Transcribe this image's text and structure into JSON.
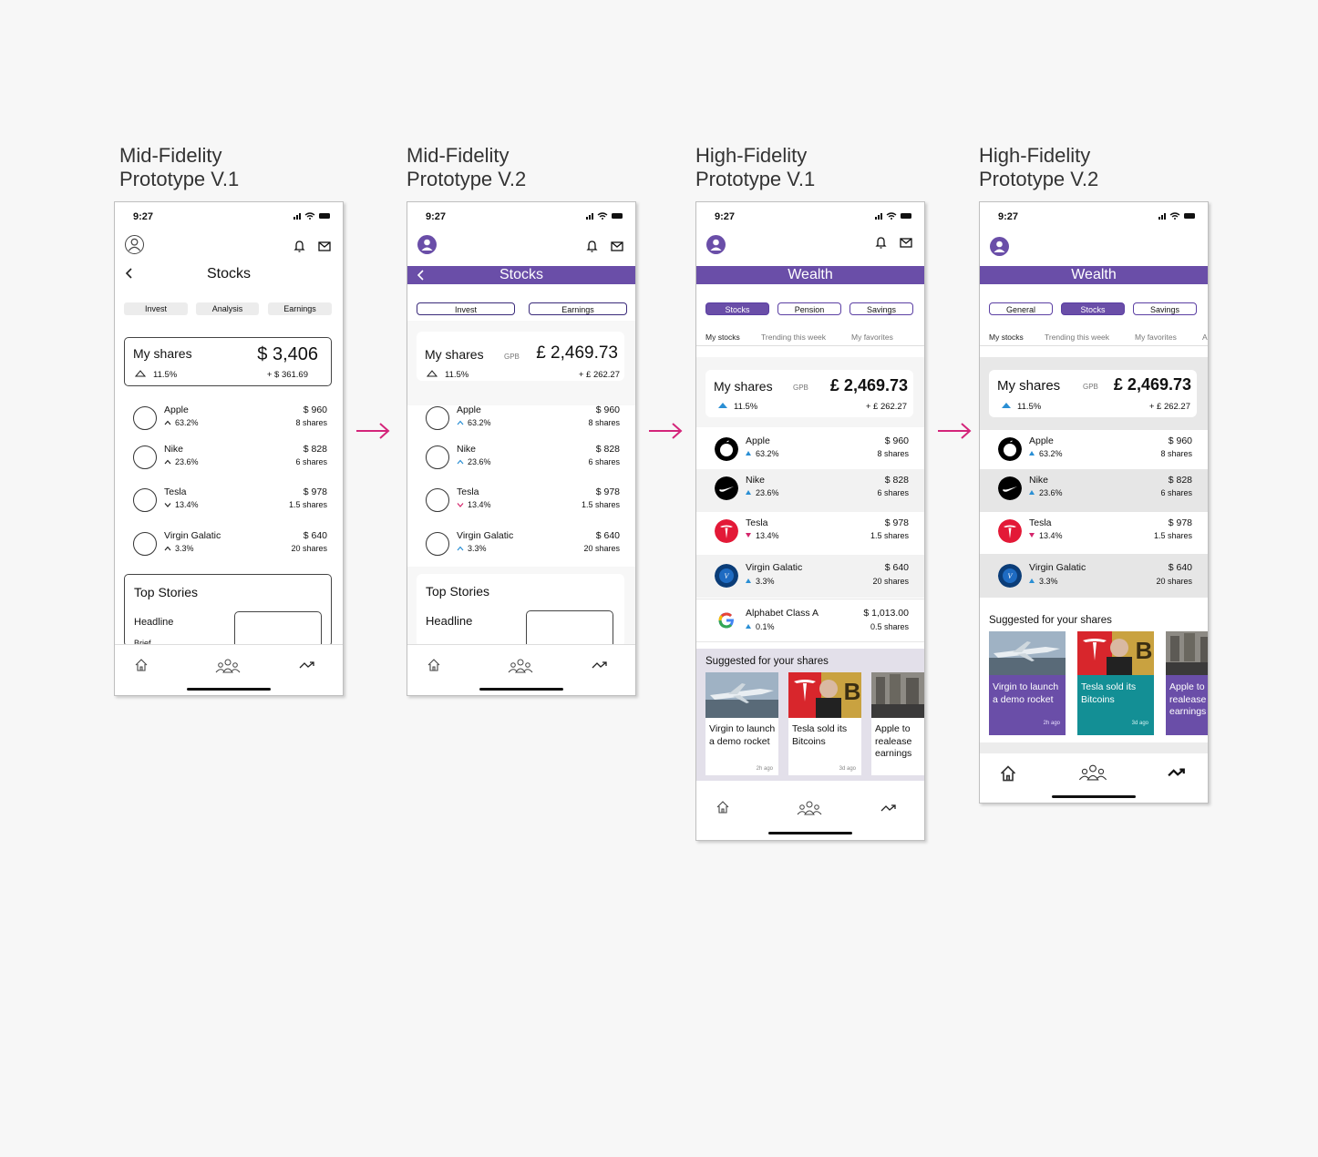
{
  "columns": [
    {
      "title": "Mid-Fidelity\nPrototype V.1"
    },
    {
      "title": "Mid-Fidelity\nPrototype V.2"
    },
    {
      "title": "High-Fidelity\nPrototype V.1"
    },
    {
      "title": "High-Fidelity\nPrototype V.2"
    }
  ],
  "colors": {
    "purple": "#6a4ea8",
    "arrow": "#d4257a",
    "up": "#2a8fd4",
    "down": "#d4256b",
    "teal": "#138f95"
  },
  "p1": {
    "time": "9:27",
    "title": "Stocks",
    "tabs": [
      "Invest",
      "Analysis",
      "Earnings"
    ],
    "shares": {
      "label": "My shares",
      "amount": "$ 3,406",
      "pct": "11.5%",
      "gain": "+ $ 361.69"
    },
    "stocks": [
      {
        "name": "Apple",
        "chg": "63.2%",
        "val": "$ 960",
        "shares": "8 shares"
      },
      {
        "name": "Nike",
        "chg": "23.6%",
        "val": "$ 828",
        "shares": "6 shares"
      },
      {
        "name": "Tesla",
        "chg": "13.4%",
        "val": "$ 978",
        "shares": "1.5 shares"
      },
      {
        "name": "Virgin Galatic",
        "chg": "3.3%",
        "val": "$ 640",
        "shares": "20 shares"
      }
    ],
    "stories": {
      "title": "Top Stories",
      "headline": "Headline",
      "brief": "Brief"
    }
  },
  "p2": {
    "time": "9:27",
    "title": "Stocks",
    "tabs": [
      "Invest",
      "Earnings"
    ],
    "shares": {
      "label": "My shares",
      "currency": "GPB",
      "amount": "£ 2,469.73",
      "pct": "11.5%",
      "gain": "+ £ 262.27"
    },
    "stocks": [
      {
        "name": "Apple",
        "chg": "63.2%",
        "val": "$ 960",
        "shares": "8 shares"
      },
      {
        "name": "Nike",
        "chg": "23.6%",
        "val": "$ 828",
        "shares": "6 shares"
      },
      {
        "name": "Tesla",
        "chg": "13.4%",
        "val": "$ 978",
        "shares": "1.5 shares"
      },
      {
        "name": "Virgin Galatic",
        "chg": "3.3%",
        "val": "$ 640",
        "shares": "20 shares"
      }
    ],
    "stories": {
      "title": "Top Stories",
      "headline": "Headline"
    }
  },
  "p3": {
    "time": "9:27",
    "title": "Wealth",
    "tabs": [
      "Stocks",
      "Pension",
      "Savings"
    ],
    "subtabs": [
      "My stocks",
      "Trending this week",
      "My favorites"
    ],
    "shares": {
      "label": "My shares",
      "currency": "GPB",
      "amount": "£ 2,469.73",
      "pct": "11.5%",
      "gain": "+ £ 262.27"
    },
    "stocks": [
      {
        "name": "Apple",
        "chg": "63.2%",
        "val": "$ 960",
        "shares": "8 shares"
      },
      {
        "name": "Nike",
        "chg": "23.6%",
        "val": "$ 828",
        "shares": "6 shares"
      },
      {
        "name": "Tesla",
        "chg": "13.4%",
        "val": "$ 978",
        "shares": "1.5 shares"
      },
      {
        "name": "Virgin Galatic",
        "chg": "3.3%",
        "val": "$ 640",
        "shares": "20 shares"
      },
      {
        "name": "Alphabet Class A",
        "chg": "0.1%",
        "val": "$ 1,013.00",
        "shares": "0.5 shares"
      }
    ],
    "suggested": {
      "title": "Suggested for your shares",
      "items": [
        {
          "text": "Virgin to launch a demo rocket",
          "ago": "2h ago"
        },
        {
          "text": "Tesla sold its Bitcoins",
          "ago": "3d ago"
        },
        {
          "text": "Apple to realease earnings",
          "ago": "1"
        }
      ]
    }
  },
  "p4": {
    "time": "9:27",
    "title": "Wealth",
    "tabs": [
      "General",
      "Stocks",
      "Savings"
    ],
    "subtabs": [
      "My stocks",
      "Trending this week",
      "My favorites",
      "A"
    ],
    "shares": {
      "label": "My shares",
      "currency": "GPB",
      "amount": "£ 2,469.73",
      "pct": "11.5%",
      "gain": "+ £ 262.27"
    },
    "stocks": [
      {
        "name": "Apple",
        "chg": "63.2%",
        "val": "$ 960",
        "shares": "8 shares"
      },
      {
        "name": "Nike",
        "chg": "23.6%",
        "val": "$ 828",
        "shares": "6 shares"
      },
      {
        "name": "Tesla",
        "chg": "13.4%",
        "val": "$ 978",
        "shares": "1.5 shares"
      },
      {
        "name": "Virgin Galatic",
        "chg": "3.3%",
        "val": "$ 640",
        "shares": "20 shares"
      }
    ],
    "suggested": {
      "title": "Suggested for your shares",
      "items": [
        {
          "text": "Virgin to launch a demo rocket",
          "ago": "2h ago"
        },
        {
          "text": "Tesla sold its Bitcoins",
          "ago": "3d ago"
        },
        {
          "text": "Apple to realease earnings",
          "ago": ""
        }
      ]
    }
  }
}
